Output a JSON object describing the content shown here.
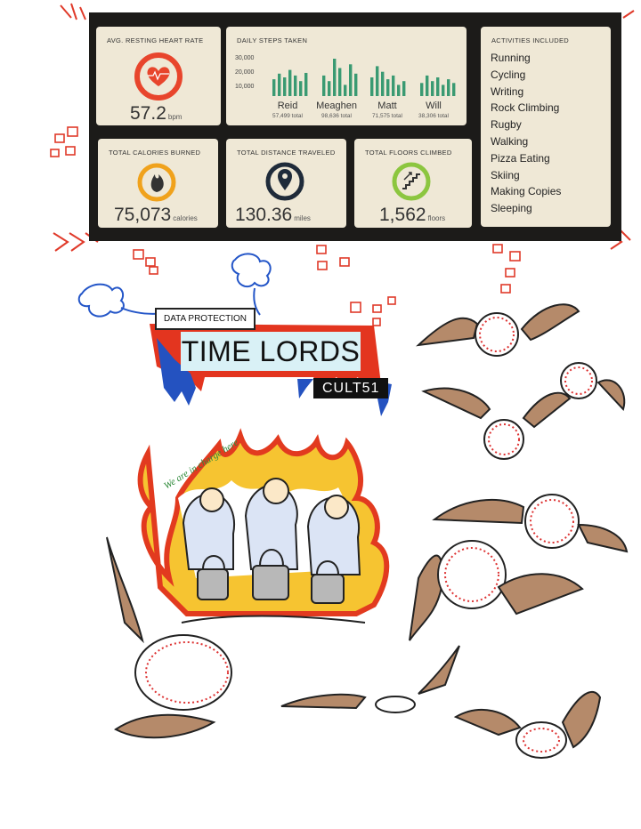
{
  "dashboard": {
    "heart": {
      "title": "AVG. RESTING HEART RATE",
      "value": "57.2",
      "unit": "bpm",
      "ring_color": "#e8452c"
    },
    "steps": {
      "title": "DAILY STEPS TAKEN",
      "yticks": [
        "30,000",
        "20,000",
        "10,000"
      ],
      "people": [
        {
          "name": "Reid",
          "total": "57,499 total"
        },
        {
          "name": "Meaghen",
          "total": "98,636 total"
        },
        {
          "name": "Matt",
          "total": "71,575 total"
        },
        {
          "name": "Will",
          "total": "38,306 total"
        }
      ],
      "bar_color": "#3a9a72"
    },
    "activities": {
      "title": "ACTIVITIES INCLUDED",
      "items": [
        "Running",
        "Cycling",
        "Writing",
        "Rock Climbing",
        "Rugby",
        "Walking",
        "Pizza Eating",
        "Skiing",
        "Making Copies",
        "Sleeping"
      ]
    },
    "calories": {
      "title": "TOTAL CALORIES BURNED",
      "value": "75,073",
      "unit": "calories",
      "ring_color": "#f0a21c"
    },
    "distance": {
      "title": "TOTAL DISTANCE TRAVELED",
      "value": "130.36",
      "unit": "miles",
      "ring_color": "#1f2b3a"
    },
    "floors": {
      "title": "TOTAL FLOORS CLIMBED",
      "value": "1,562",
      "unit": "floors",
      "ring_color": "#8cc63f"
    }
  },
  "banner": {
    "tag": "DATA PROTECTION",
    "title": "TIME LORDS",
    "code": "CULT51"
  },
  "handwriting": {
    "text": "We are in charge here"
  }
}
